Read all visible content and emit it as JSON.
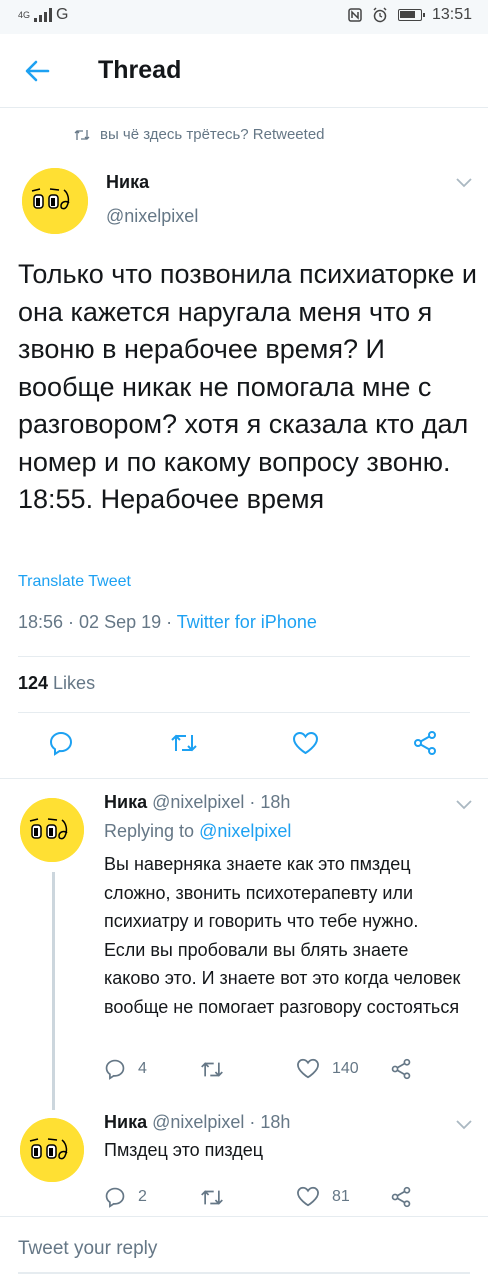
{
  "status_bar": {
    "network": "4G",
    "carrier_icon": "G",
    "time": "13:51"
  },
  "app_bar": {
    "title": "Thread",
    "back_icon": "arrow-left-icon"
  },
  "retweet_line": {
    "text": "вы чё здесь трётесь? Retweeted"
  },
  "main_tweet": {
    "name": "Ника",
    "handle": "@nixelpixel",
    "text": "Только что позвонила психиаторке и она кажется наругала меня что я звоню в нерабочее время? И вообще никак не помогала мне с разговором? хотя я сказала кто дал номер и по какому вопросу звоню. 18:55. Нерабочее время",
    "translate": "Translate Tweet",
    "timestamp": "18:56 · 02 Sep 19 · ",
    "source": "Twitter for iPhone",
    "likes_count": "124",
    "likes_label": " Likes"
  },
  "replies": [
    {
      "name": "Ника",
      "handle_time": " @nixelpixel · 18h",
      "replying_prefix": "Replying to ",
      "replying_to": "@nixelpixel",
      "text": "Вы наверняка знаете как это пмздец сложно, звонить психотерапевту или психиатру и говорить что тебе нужно. Если вы пробовали вы блять знаете каково это. И знаете вот это когда человек вообще не помогает разговору состояться",
      "replies_count": "4",
      "likes_count": "140"
    },
    {
      "name": "Ника",
      "handle_time": " @nixelpixel · 18h",
      "text": "Пмздец это пиздец",
      "replies_count": "2",
      "likes_count": "81"
    }
  ],
  "compose": {
    "placeholder": "Tweet your reply"
  },
  "colors": {
    "accent": "#1da1f2",
    "secondary_text": "#657786",
    "avatar_bg": "#ffe033"
  }
}
